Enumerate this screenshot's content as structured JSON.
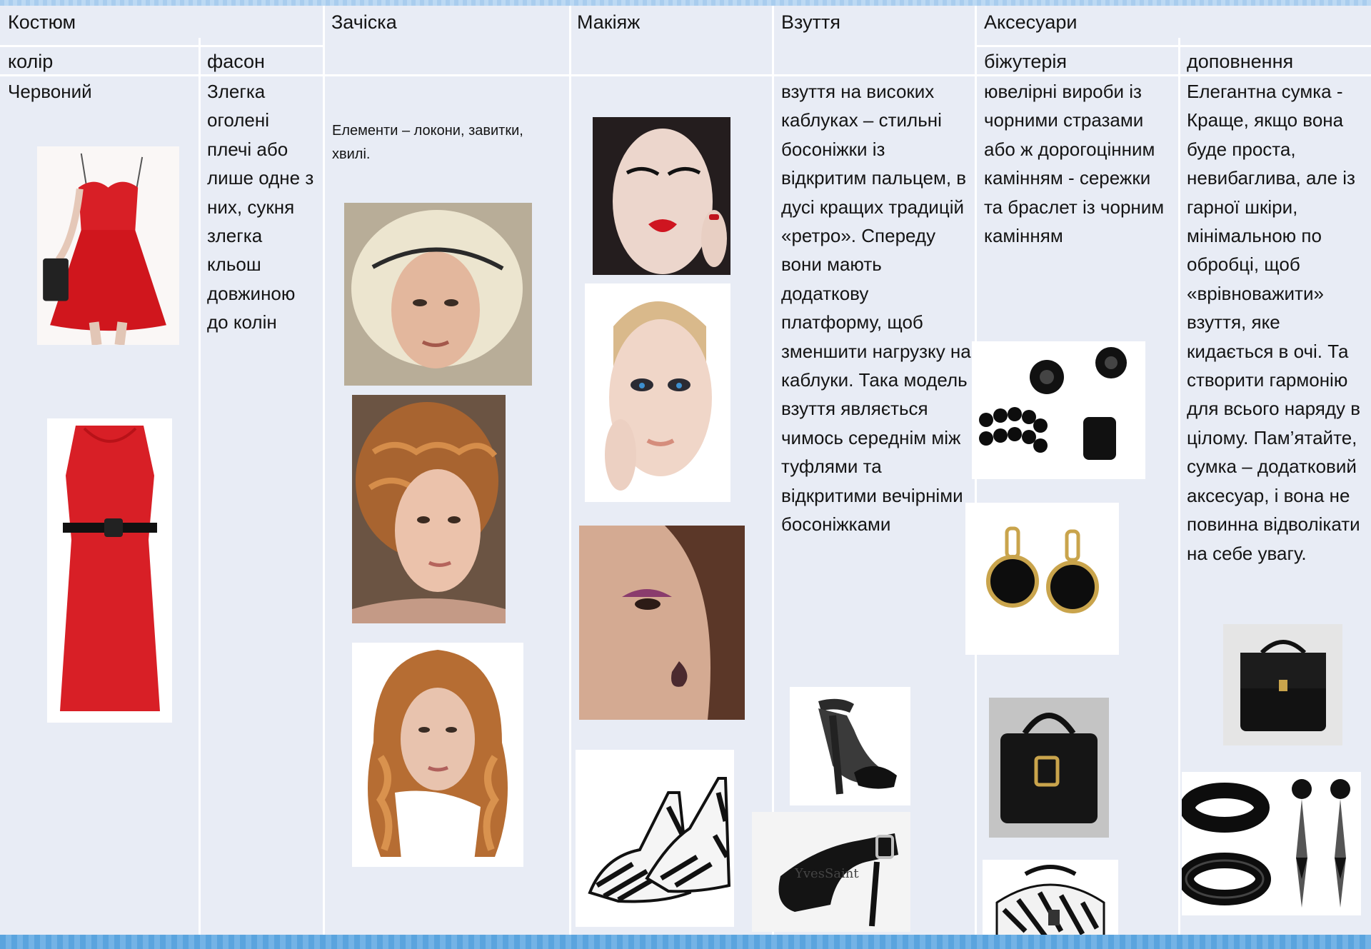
{
  "headers": {
    "costume": "Костюм",
    "hairstyle": "Зачіска",
    "makeup": "Макіяж",
    "shoes": "Взуття",
    "accessories": "Аксесуари"
  },
  "subheaders": {
    "color": "колір",
    "style": "фасон",
    "jewelry": "біжутерія",
    "extras": "доповнення"
  },
  "cells": {
    "color": "Червоний",
    "style": "Злегка оголені плечі або лише одне з них, сукня злегка кльош довжиною до колін",
    "hairstyle": "Елементи – локони, завитки, хвилі.",
    "shoes": "взуття на високих каблуках – стильні босоніжки із відкритим пальцем, в дусі кращих традицій «ретро». Спереду вони мають додаткову платформу, щоб зменшити нагрузку на каблуки. Така модель взуття являється чимось середнім між туфлями та відкритими вечірніми босоніжками",
    "jewelry": "ювелірні вироби із чорними стразами або ж дорогоцінним камінням - сережки та браслет із чорним камінням",
    "extras": "Елегантна сумка - Краще, якщо вона буде проста, невибаглива, але із гарної шкіри, мінімальною по обробці, щоб «врівноважити» взуття, яке кидається в очі. Та створити гармонію для всього наряду в цілому.  Пам’ятайте, сумка – додатковий аксесуар, і вона не повинна відволікати на себе увагу."
  },
  "colors": {
    "background": "#e8ecf5",
    "grid": "#ffffff",
    "dress_red": "#d81f26",
    "top_band": "#a9cdee",
    "bottom_band": "#5aa4de"
  }
}
